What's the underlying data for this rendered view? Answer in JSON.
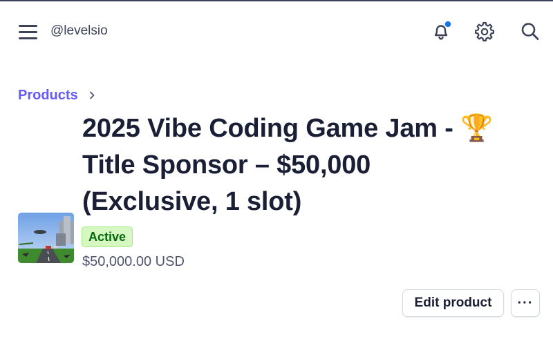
{
  "header": {
    "menu_icon": "hamburger-menu-icon",
    "username": "@levelsio",
    "notification_icon": "bell-icon",
    "notification_dot_color": "#1a73e8",
    "settings_icon": "gear-icon",
    "search_icon": "search-icon"
  },
  "breadcrumb": {
    "label": "Products",
    "separator_icon": "chevron-right-icon"
  },
  "product": {
    "title_line1": "2025 Vibe Coding Game Jam - 🏆",
    "title_line2": "Title Sponsor – $50,000",
    "title_line3": "(Exclusive, 1 slot)",
    "status": "Active",
    "status_color": "#05690d",
    "price": "$50,000.00 USD",
    "thumbnail_icon": "game-screenshot-thumbnail"
  },
  "actions": {
    "edit_label": "Edit product",
    "more_label": "···"
  },
  "colors": {
    "accent": "#635bff",
    "text": "#1a1f36",
    "muted": "#4f566b"
  }
}
